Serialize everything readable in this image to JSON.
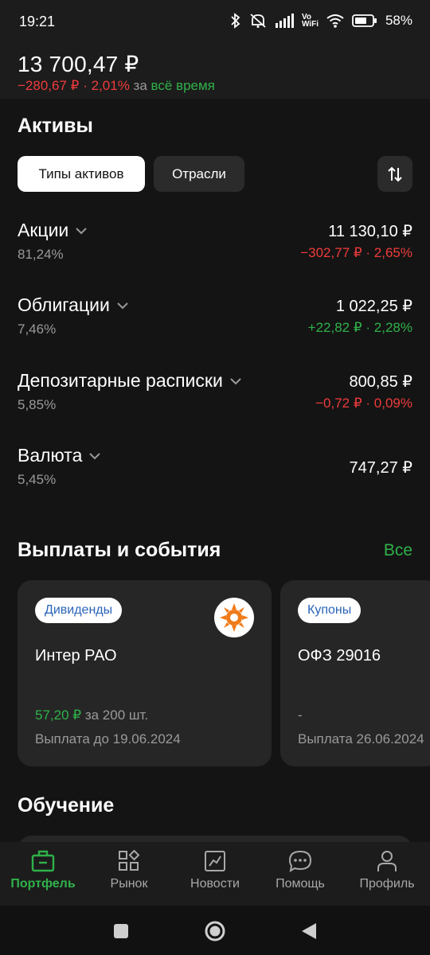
{
  "status": {
    "time": "19:21",
    "battery": "58%",
    "wifi_label": "Vo WiFi",
    "icons": [
      "bluetooth-icon",
      "mute-icon",
      "signal-icon",
      "vowifi-icon",
      "wifi-icon",
      "battery-icon"
    ]
  },
  "summary": {
    "total": "13 700,47 ₽",
    "change_amount": "−280,67 ₽",
    "change_separator": "·",
    "change_percent": "2,01%",
    "period_prefix": "за",
    "period_link": "всё время"
  },
  "assets": {
    "title": "Активы",
    "tabs": [
      {
        "label": "Типы активов",
        "active": true
      },
      {
        "label": "Отрасли",
        "active": false
      }
    ],
    "items": [
      {
        "name": "Акции",
        "share": "81,24%",
        "value": "11 130,10 ₽",
        "change": "−302,77 ₽ · 2,65%",
        "trend": "down"
      },
      {
        "name": "Облигации",
        "share": "7,46%",
        "value": "1 022,25 ₽",
        "change": "+22,82 ₽ · 2,28%",
        "trend": "up"
      },
      {
        "name": "Депозитарные расписки",
        "share": "5,85%",
        "value": "800,85 ₽",
        "change": "−0,72 ₽ · 0,09%",
        "trend": "down"
      },
      {
        "name": "Валюта",
        "share": "5,45%",
        "value": "747,27 ₽",
        "change": "",
        "trend": "none"
      }
    ]
  },
  "events": {
    "title": "Выплаты и события",
    "all_link": "Все",
    "cards": [
      {
        "badge": "Дивиденды",
        "title": "Интер РАО",
        "amount": "57,20 ₽",
        "amount_suffix": "за 200 шт.",
        "date": "Выплата до 19.06.2024"
      },
      {
        "badge": "Купоны",
        "title": "ОФЗ 29016",
        "amount": "-",
        "amount_suffix": "",
        "date": "Выплата 26.06.2024"
      }
    ]
  },
  "education": {
    "title": "Обучение"
  },
  "nav": {
    "items": [
      {
        "label": "Портфель",
        "icon": "briefcase-icon",
        "active": true
      },
      {
        "label": "Рынок",
        "icon": "market-grid-icon",
        "active": false
      },
      {
        "label": "Новости",
        "icon": "chart-news-icon",
        "active": false
      },
      {
        "label": "Помощь",
        "icon": "chat-help-icon",
        "active": false
      },
      {
        "label": "Профиль",
        "icon": "person-icon",
        "active": false
      }
    ]
  },
  "colors": {
    "background": "#141414",
    "card": "#262626",
    "green": "#2fb14a",
    "red": "#ef3b3b",
    "badge_text": "#2a64b8"
  }
}
